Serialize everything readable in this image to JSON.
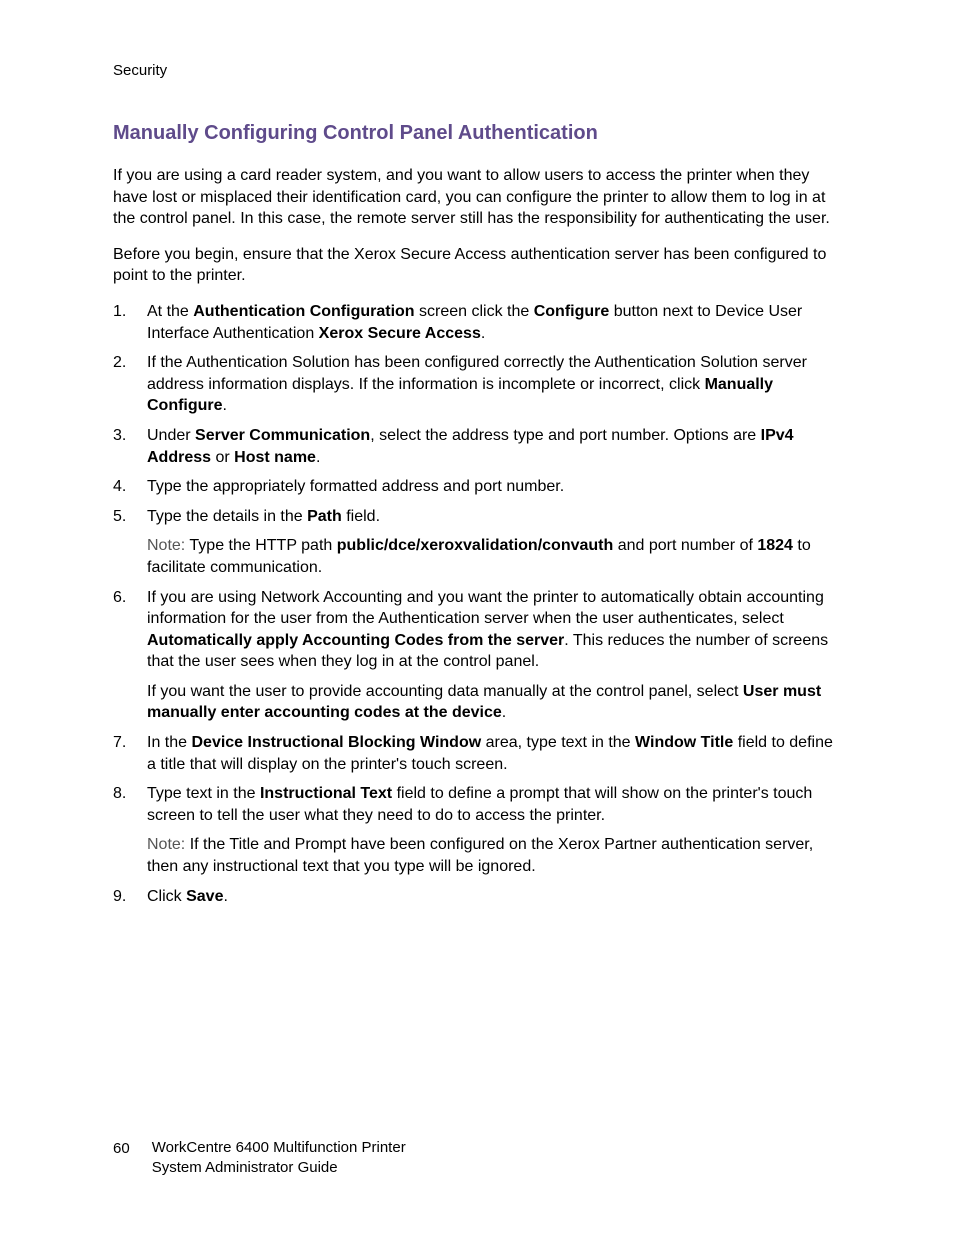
{
  "header": {
    "label": "Security"
  },
  "heading": "Manually Configuring Control Panel Authentication",
  "para1": "If you are using a card reader system, and you want to allow users to access the printer when they have lost or misplaced their identification card, you can configure the printer to allow them to log in at the control panel. In this case, the remote server still has the responsibility for authenticating the user.",
  "para2": "Before you begin, ensure that the Xerox Secure Access authentication server has been configured to point to the printer.",
  "steps": {
    "s1": {
      "t1": "At the ",
      "b1": "Authentication Configuration",
      "t2": " screen click the ",
      "b2": "Configure",
      "t3": " button next to Device User Interface Authentication ",
      "b3": "Xerox Secure Access",
      "t4": "."
    },
    "s2": {
      "t1": "If the Authentication Solution has been configured correctly the Authentication Solution server address information displays. If the information is incomplete or incorrect, click ",
      "b1": "Manually Configure",
      "t2": "."
    },
    "s3": {
      "t1": "Under ",
      "b1": "Server Communication",
      "t2": ", select the address type and port number. Options are ",
      "b2": "IPv4 Address",
      "t3": " or ",
      "b3": "Host name",
      "t4": "."
    },
    "s4": {
      "t1": "Type the appropriately formatted address and port number."
    },
    "s5": {
      "t1": "Type the details in the ",
      "b1": "Path",
      "t2": " field.",
      "note": {
        "label": "Note:",
        "t1": " Type the HTTP path ",
        "b1": "public/dce/xeroxvalidation/convauth",
        "t2": " and port number of ",
        "b2": "1824",
        "t3": " to facilitate communication."
      }
    },
    "s6": {
      "t1": "If you are using Network Accounting and you want the printer to automatically obtain accounting information for the user from the Authentication server when the user authenticates, select ",
      "b1": "Automatically apply Accounting Codes from the server",
      "t2": ". This reduces the number of screens that the user sees when they log in at the control panel.",
      "sub": {
        "t1": "If you want the user to provide accounting data manually at the control panel, select ",
        "b1": "User must manually enter accounting codes at the device",
        "t2": "."
      }
    },
    "s7": {
      "t1": "In the ",
      "b1": "Device Instructional Blocking Window",
      "t2": " area, type text in the ",
      "b2": "Window Title",
      "t3": " field to define a title that will display on the printer's touch screen."
    },
    "s8": {
      "t1": "Type text in the ",
      "b1": "Instructional Text",
      "t2": " field to define a prompt that will show on the printer's touch screen to tell the user what they need to do to access the printer.",
      "note": {
        "label": "Note:",
        "t1": " If the Title and Prompt have been configured on the Xerox Partner authentication server, then any instructional text that you type will be ignored."
      }
    },
    "s9": {
      "t1": "Click ",
      "b1": "Save",
      "t2": "."
    }
  },
  "footer": {
    "page": "60",
    "line1": "WorkCentre 6400 Multifunction Printer",
    "line2": "System Administrator Guide"
  }
}
